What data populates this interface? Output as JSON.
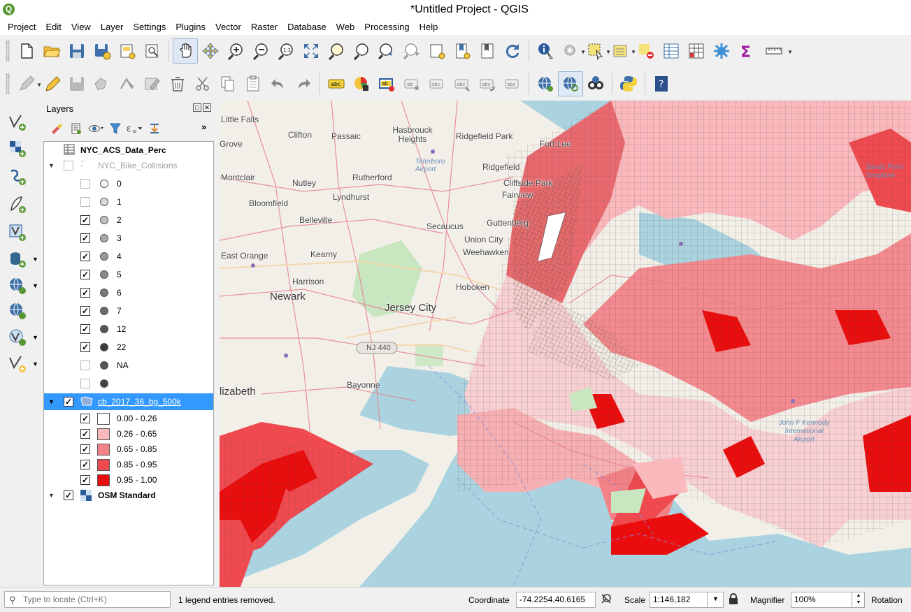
{
  "window": {
    "title": "*Untitled Project - QGIS",
    "app_icon": "Q"
  },
  "menu": [
    "Project",
    "Edit",
    "View",
    "Layer",
    "Settings",
    "Plugins",
    "Vector",
    "Raster",
    "Database",
    "Web",
    "Processing",
    "Help"
  ],
  "layers_panel": {
    "title": "Layers",
    "more": "»",
    "layers": [
      {
        "name": "NYC_ACS_Data_Perc",
        "type": "table",
        "bold": true
      },
      {
        "name": "NYC_Bike_Collisions",
        "type": "points",
        "visible": false,
        "expanded": true,
        "classes": [
          {
            "label": "0",
            "checked": false,
            "color": "#f5f5f5"
          },
          {
            "label": "1",
            "checked": false,
            "color": "#d8d8d8"
          },
          {
            "label": "2",
            "checked": true,
            "color": "#c0c0c0"
          },
          {
            "label": "3",
            "checked": true,
            "color": "#aaaaaa"
          },
          {
            "label": "4",
            "checked": true,
            "color": "#999999"
          },
          {
            "label": "5",
            "checked": true,
            "color": "#888888"
          },
          {
            "label": "6",
            "checked": true,
            "color": "#777777"
          },
          {
            "label": "7",
            "checked": true,
            "color": "#6a6a6a"
          },
          {
            "label": "12",
            "checked": true,
            "color": "#555555"
          },
          {
            "label": "22",
            "checked": true,
            "color": "#3a3a3a"
          },
          {
            "label": "NA",
            "checked": false,
            "color": "#555555"
          },
          {
            "label": "",
            "checked": false,
            "color": "#444444"
          }
        ]
      },
      {
        "name": "cb_2017_36_bg_500k",
        "type": "polygons",
        "visible": true,
        "expanded": true,
        "selected": true,
        "classes": [
          {
            "label": "0.00 - 0.26",
            "checked": true,
            "color": "#ffffff"
          },
          {
            "label": "0.26 - 0.65",
            "checked": true,
            "color": "#f9b9bd"
          },
          {
            "label": "0.65 - 0.85",
            "checked": true,
            "color": "#f38287"
          },
          {
            "label": "0.85 - 0.95",
            "checked": true,
            "color": "#ee4a4f"
          },
          {
            "label": "0.95 - 1.00",
            "checked": true,
            "color": "#ea0d0d"
          }
        ]
      },
      {
        "name": "OSM Standard",
        "type": "raster",
        "visible": true,
        "bold": true
      }
    ]
  },
  "map": {
    "place_labels": [
      "Little Falls",
      "Clifton",
      "Passaic",
      "Hasbrouck Heights",
      "Ridgefield Park",
      "Fort Lee",
      "Grove",
      "Teterboro Airport",
      "Ridgefield",
      "Montclair",
      "Nutley",
      "Rutherford",
      "Cliffside Park",
      "Fairview",
      "Lyndhurst",
      "Bloomfield",
      "Belleville",
      "Secaucus",
      "Guttenberg",
      "Union City",
      "Weehawken",
      "East Orange",
      "Kearny",
      "Harrison",
      "Hoboken",
      "Newark",
      "Jersey City",
      "NJ 440",
      "Bayonne",
      "lizabeth",
      "John F Kennedy International Airport",
      "Sands Point Seaplane"
    ]
  },
  "statusbar": {
    "locator_placeholder": "Type to locate (Ctrl+K)",
    "message": "1 legend entries removed.",
    "coordinate_label": "Coordinate",
    "coordinate_value": "-74.2254,40.6165",
    "scale_label": "Scale",
    "scale_value": "1:146,182",
    "magnifier_label": "Magnifier",
    "magnifier_value": "100%",
    "rotation_label": "Rotation"
  }
}
